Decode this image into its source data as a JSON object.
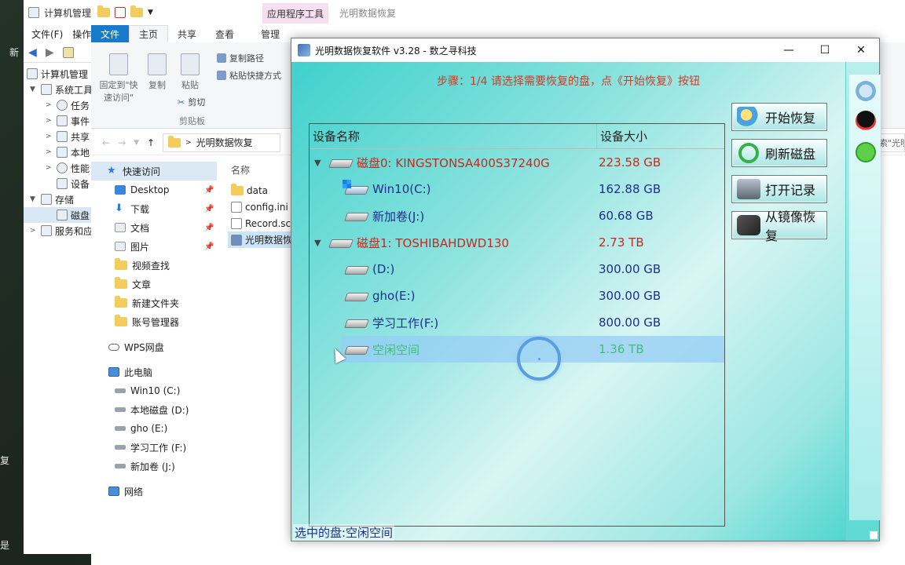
{
  "desktop": {
    "left_text_1": "新",
    "left_text_2": "复",
    "left_text_3": "是"
  },
  "computer_management": {
    "title": "计算机管理",
    "menu": [
      "文件(F)",
      "操作"
    ],
    "tree": [
      {
        "label": "计算机管理"
      },
      {
        "label": "系统工具"
      },
      {
        "label": "任务"
      },
      {
        "label": "事件"
      },
      {
        "label": "共享"
      },
      {
        "label": "本地"
      },
      {
        "label": "性能"
      },
      {
        "label": "设备"
      },
      {
        "label": "存储"
      },
      {
        "label": "磁盘"
      },
      {
        "label": "服务和应"
      }
    ]
  },
  "explorer": {
    "context_tab": "应用程序工具",
    "title": "光明数据恢复",
    "tabs": {
      "file": "文件",
      "home": "主页",
      "share": "共享",
      "view": "查看",
      "manage": "管理"
    },
    "ribbon": {
      "pin": "固定到\"快速访问\"",
      "copy": "复制",
      "paste": "粘贴",
      "copy_path": "复制路径",
      "paste_shortcut": "粘贴快捷方式",
      "cut": "剪切",
      "group_clipboard": "剪贴板"
    },
    "address": "光明数据恢复",
    "search": "索\"光明",
    "nav": {
      "quick_access": "快速访问",
      "items": [
        {
          "label": "Desktop",
          "pinned": true
        },
        {
          "label": "下载",
          "pinned": true
        },
        {
          "label": "文档",
          "pinned": true
        },
        {
          "label": "图片",
          "pinned": true
        },
        {
          "label": "视频查找"
        },
        {
          "label": "文章"
        },
        {
          "label": "新建文件夹"
        },
        {
          "label": "账号管理器"
        }
      ],
      "wps": "WPS网盘",
      "this_pc": "此电脑",
      "drives": [
        "Win10 (C:)",
        "本地磁盘 (D:)",
        "gho (E:)",
        "学习工作 (F:)",
        "新加卷 (J:)"
      ],
      "network": "网络"
    },
    "files": {
      "header": "名称",
      "items": [
        "data",
        "config.ini",
        "Record.sc",
        "光明数据恢"
      ]
    }
  },
  "app": {
    "title": "光明数据恢复软件 v3.28 - 数之寻科技",
    "step": "步骤：1/4 请选择需要恢复的盘，点《开始恢复》按钮",
    "columns": {
      "name": "设备名称",
      "size": "设备大小"
    },
    "rows": [
      {
        "name": "磁盘0: KINGSTONSA400S37240G",
        "size": "223.58 GB"
      },
      {
        "name": "Win10(C:)",
        "size": "162.88 GB"
      },
      {
        "name": "新加卷(J:)",
        "size": "60.68 GB"
      },
      {
        "name": "磁盘1: TOSHIBAHDWD130",
        "size": "2.73 TB"
      },
      {
        "name": "(D:)",
        "size": "300.00 GB"
      },
      {
        "name": "gho(E:)",
        "size": "300.00 GB"
      },
      {
        "name": "学习工作(F:)",
        "size": "800.00 GB"
      },
      {
        "name": "空闲空间",
        "size": "1.36 TB"
      }
    ],
    "buttons": {
      "start": "开始恢复",
      "refresh": "刷新磁盘",
      "open_record": "打开记录",
      "from_image": "从镜像恢复"
    },
    "status": "选中的盘:空闲空间"
  }
}
